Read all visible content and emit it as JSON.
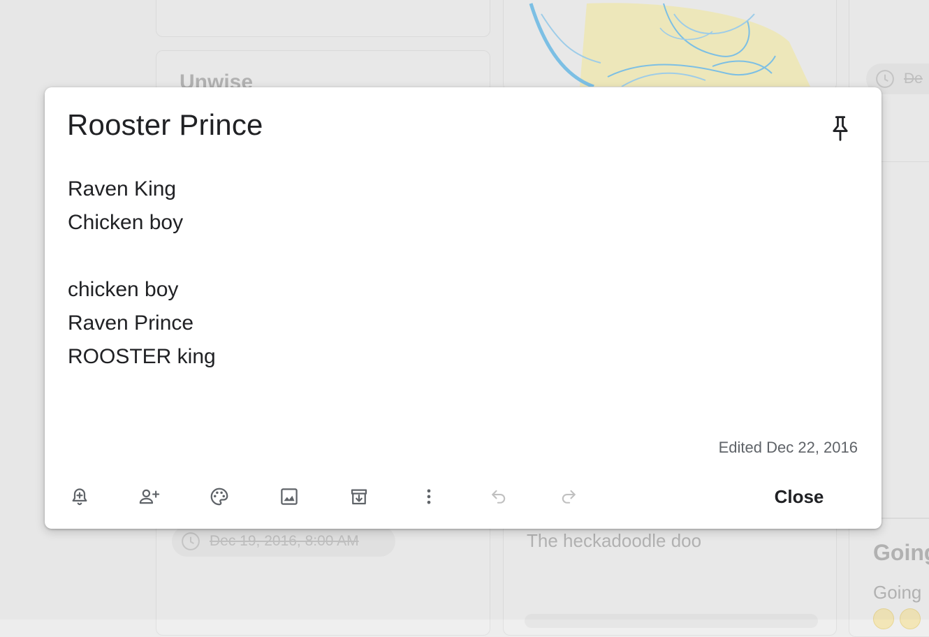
{
  "background": {
    "left_column": {
      "card2_title": "Unwise",
      "reminder_chip": "Dec 19, 2016, 8:00 AM"
    },
    "middle_column": {
      "note_text": "The heckadoodle doo"
    },
    "right_column": {
      "reminder_chip": "De",
      "note_title": "Going",
      "note_text": "Going"
    }
  },
  "note": {
    "title": "Rooster Prince",
    "lines": [
      "Raven King",
      "Chicken boy",
      "",
      "chicken boy",
      "Raven Prince",
      "ROOSTER king"
    ],
    "edited": "Edited Dec 22, 2016",
    "close_label": "Close"
  },
  "toolbar": {
    "icons": [
      "remind-me-icon",
      "collaborator-icon",
      "color-palette-icon",
      "add-image-icon",
      "archive-icon",
      "more-icon",
      "undo-icon",
      "redo-icon"
    ]
  },
  "colors": {
    "icon": "#5f6368",
    "icon_disabled": "#c0c0c0",
    "text": "#202124",
    "sketch_blue": "#7cc3ea",
    "sketch_yellow": "#f6ecae"
  }
}
